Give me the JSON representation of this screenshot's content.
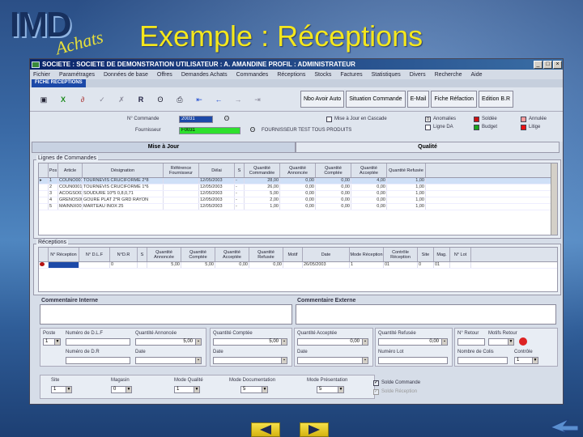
{
  "slide": {
    "title": "Exemple : Réceptions",
    "logo_main": "IMD",
    "logo_sub": "Achats",
    "corner_icon": "back-arrow-icon",
    "nav": {
      "prev_icon": "prev-triangle-icon",
      "next_icon": "next-triangle-icon"
    }
  },
  "window": {
    "title": "SOCIETE : SOCIETE DE DEMONSTRATION   UTILISATEUR : A. AMANDINE   PROFIL : ADMINISTRATEUR",
    "menu": [
      "Fichier",
      "Paramétrages",
      "Données de base",
      "Offres",
      "Demandes Achats",
      "Commandes",
      "Réceptions",
      "Stocks",
      "Factures",
      "Statistiques",
      "Divers",
      "Recherche",
      "Aide"
    ],
    "active_tab": "FICHE RECEPTIONS"
  },
  "toolbar": {
    "icons": [
      "new-icon",
      "excel-icon",
      "attach-icon",
      "validate-icon",
      "cancel-icon",
      "print-icon",
      "binoculars-icon",
      "printer-icon",
      "first-icon",
      "prev-icon",
      "next-icon",
      "last-icon"
    ],
    "buttons": [
      "Nbo Avoir Auto",
      "Situation Commande",
      "E-Mail",
      "Fiche Réfaction",
      "Edition B.R"
    ]
  },
  "header": {
    "cmd_label": "N° Commande",
    "cmd_value": "20031",
    "four_label": "Fournisseur",
    "four_code": "F0031",
    "four_name": "FOURNISSEUR TEST TOUS PRODUITS",
    "cascade_label": "Mise à Jour en Cascade",
    "ligne_label": "Ligne DA",
    "legend": [
      {
        "label": "Anomalies",
        "color": "#ffffff"
      },
      {
        "label": "Soldée",
        "color": "#cc1111"
      },
      {
        "label": "Annulée",
        "color": "#ff9a9a"
      },
      {
        "label": "Ligne DA",
        "color": "#ffffff"
      },
      {
        "label": "Budget",
        "color": "#1aa61a"
      },
      {
        "label": "Litige",
        "color": "#ee1111"
      }
    ]
  },
  "tabs": [
    "Mise à Jour",
    "Qualité"
  ],
  "lignes": {
    "label": "Lignes de Commandes",
    "columns": [
      "Pos",
      "Article",
      "Désignation",
      "Référence Fournisseur",
      "Délai",
      "S",
      "Quantité Commandée",
      "Quantité Annoncée",
      "Quantité Comptée",
      "Quantité Acceptée",
      "Quantité Refusée"
    ],
    "rows": [
      [
        "1",
        "COUNO001",
        "TOURNEVIS CRUCIFORME 2*8",
        "12/05/2003",
        "-",
        "28,00",
        "0,00",
        "0,00",
        "4,00",
        "1,00"
      ],
      [
        "2",
        "COUN0001",
        "TOURNEVIS CRUCIFORME 1*6",
        "12/05/2003",
        "-",
        "26,00",
        "0,00",
        "0,00",
        "0,00",
        "1,00"
      ],
      [
        "3",
        "ACOGSO02",
        "SOUDURE 10*5 0,8,0,71",
        "12/05/2003",
        "-",
        "5,00",
        "0,00",
        "0,00",
        "0,00",
        "1,00"
      ],
      [
        "4",
        "GRENOS002",
        "GOURE PLAT 2*R GRD RAYON",
        "12/05/2003",
        "-",
        "2,00",
        "0,00",
        "0,00",
        "0,00",
        "1,00"
      ],
      [
        "5",
        "MAINNX001",
        "MARTEAU INOX 25",
        "12/05/2003",
        "-",
        "1,00",
        "0,00",
        "0,00",
        "0,00",
        "1,00"
      ]
    ]
  },
  "receptions": {
    "label": "Réceptions",
    "columns": [
      "N° Réception",
      "N° D.L.F",
      "N°D.R",
      "S",
      "Quantité Annoncée",
      "Quantité Comptée",
      "Quantité Acceptée",
      "Quantité Refusée",
      "Motif",
      "Date",
      "Mode Réception",
      "Contrôle Réception",
      "Site",
      "Mag.",
      "N° Lot"
    ],
    "rows": [
      [
        "",
        "",
        "0",
        "",
        "5,00",
        "5,00",
        "0,00",
        "0,00",
        "",
        "26/05/2003",
        "1",
        "01",
        "0",
        "01",
        ""
      ]
    ]
  },
  "comments": {
    "internal": "Commentaire Interne",
    "external": "Commentaire Externe"
  },
  "form": {
    "poste": "Poste",
    "poste_val": "1",
    "num_dlf": "Numéro de D.L.F",
    "num_dr": "Numéro de D.R",
    "q_annoncee": "Quantité Annoncée",
    "q_annoncee_val": "5,00",
    "date1": "Date",
    "q_comptee": "Quantité Comptée",
    "q_comptee_val": "5,00",
    "date2": "Date",
    "q_acceptee": "Quantité Acceptée",
    "q_acceptee_val": "0,00",
    "date3": "Date",
    "q_refusee": "Quantité Refusée",
    "q_refusee_val": "0,00",
    "num_lot": "Numéro Lot",
    "n_retour": "N° Retour",
    "motifs": "Motifs Retour",
    "nb_colis": "Nombre de Colis",
    "controle": "Contrôle",
    "controle_val": "1",
    "site": "Site",
    "site_val": "1",
    "magasin": "Magasin",
    "magasin_val": "0",
    "mode_qualite": "Mode Qualité",
    "mode_qualite_val": "1",
    "mode_doc": "Mode Documentation",
    "mode_doc_val": "5",
    "mode_pres": "Mode Présentation",
    "mode_pres_val": "5",
    "solde_cmd": "Solde Commande",
    "solde_rec": "Solde Réception"
  }
}
